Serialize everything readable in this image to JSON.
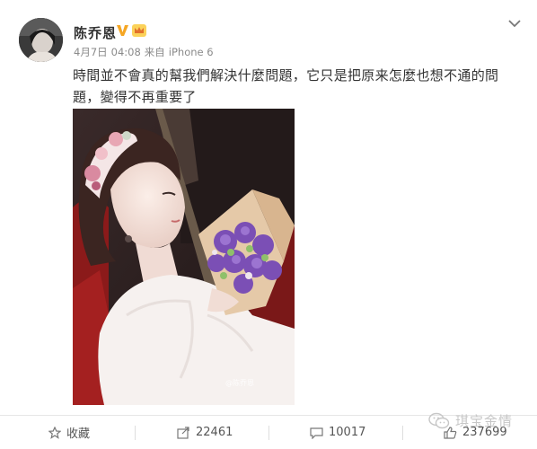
{
  "post": {
    "username": "陈乔恩",
    "date": "4月7日",
    "time": "04:08",
    "source_prefix": "来自",
    "source_device": "iPhone 6",
    "text": "時間並不會真的幫我們解決什麼問題，它只是把原来怎麼也想不通的問題，變得不再重要了",
    "photo_watermark": "@陈乔恩"
  },
  "actions": {
    "favorite_label": "收藏",
    "repost_count": "22461",
    "comment_count": "10017",
    "like_count": "237699"
  },
  "overlay": {
    "brand_text": "琪宝金情"
  },
  "icons": {
    "verified": "vip-v-icon",
    "crown": "crown-icon",
    "more": "chevron-down-icon",
    "favorite": "star-icon",
    "repost": "repost-icon",
    "comment": "comment-icon",
    "like": "thumbs-up-icon",
    "brand": "wechat-icon"
  },
  "colors": {
    "text_primary": "#333333",
    "text_secondary": "#8a8a8a",
    "vip_orange": "#f5a623",
    "divider": "#e6e6e6"
  }
}
